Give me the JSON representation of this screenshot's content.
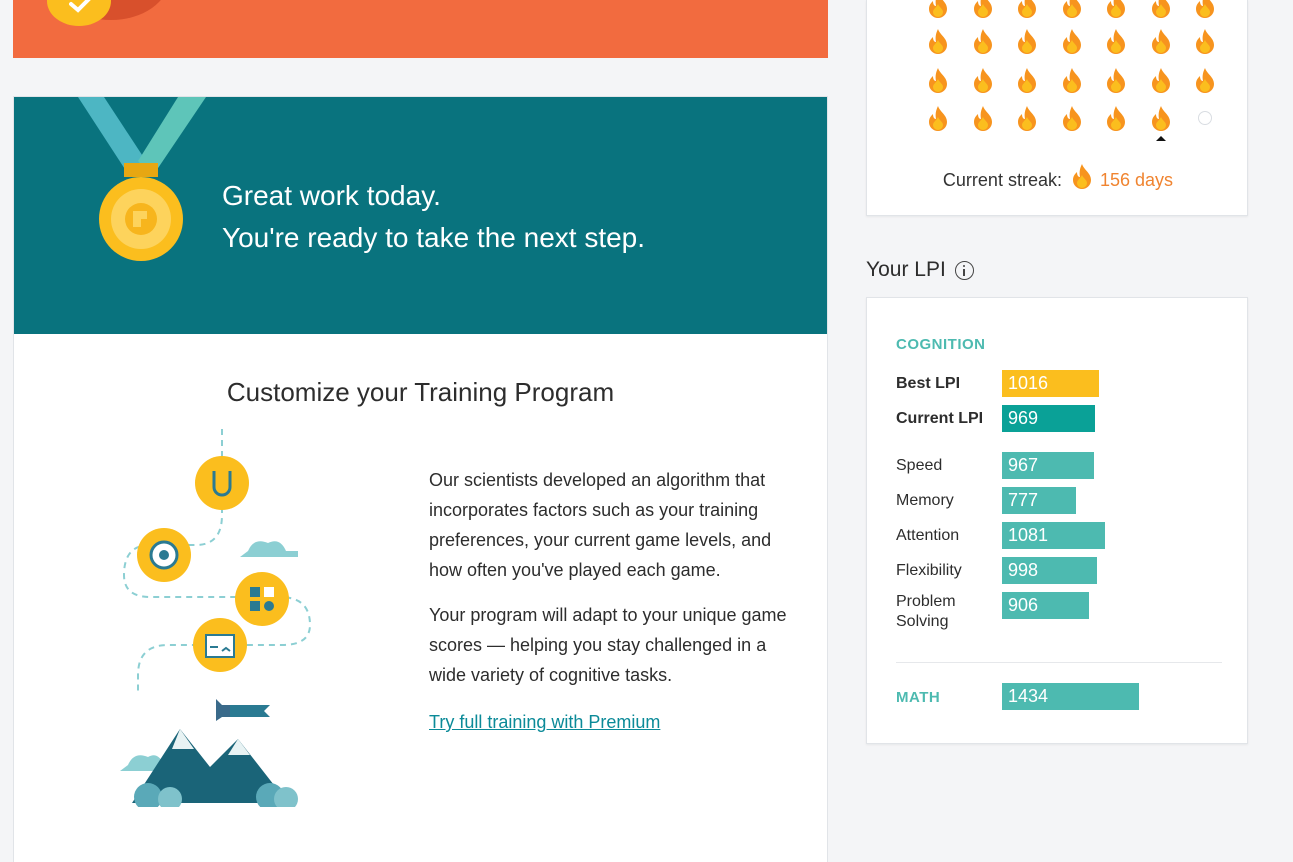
{
  "hero": {
    "line1": "Great work today.",
    "line2": "You're ready to take the next step."
  },
  "training": {
    "title": "Customize your Training Program",
    "paragraph1": "Our scientists developed an algorithm that incorporates factors such as your training preferences, your current game levels, and how often you've played each game.",
    "paragraph2": "Your program will adapt to your unique game scores — helping you stay challenged in a wide variety of cognitive tasks.",
    "link": "Try full training with Premium"
  },
  "streak": {
    "label": "Current streak:",
    "days": "156 days",
    "flame_color": "#f7941e"
  },
  "lpi": {
    "heading": "Your LPI",
    "cognition_label": "COGNITION",
    "math_label": "MATH",
    "rows": [
      {
        "label": "Best LPI",
        "value": "1016",
        "color": "#fbbe1e"
      },
      {
        "label": "Current LPI",
        "value": "969",
        "color": "#0aa197"
      },
      {
        "label": "Speed",
        "value": "967",
        "color": "#4dbab0"
      },
      {
        "label": "Memory",
        "value": "777",
        "color": "#4dbab0"
      },
      {
        "label": "Attention",
        "value": "1081",
        "color": "#4dbab0"
      },
      {
        "label": "Flexibility",
        "value": "998",
        "color": "#4dbab0"
      },
      {
        "label": "Problem Solving",
        "value": "906",
        "color": "#4dbab0"
      }
    ],
    "math": {
      "value": "1434",
      "color": "#4dbab0"
    }
  },
  "colors": {
    "banner_orange": "#f26b3f",
    "hero_teal": "#09737e",
    "accent_yellow": "#fbbe1e",
    "link_teal": "#0b8a98"
  }
}
